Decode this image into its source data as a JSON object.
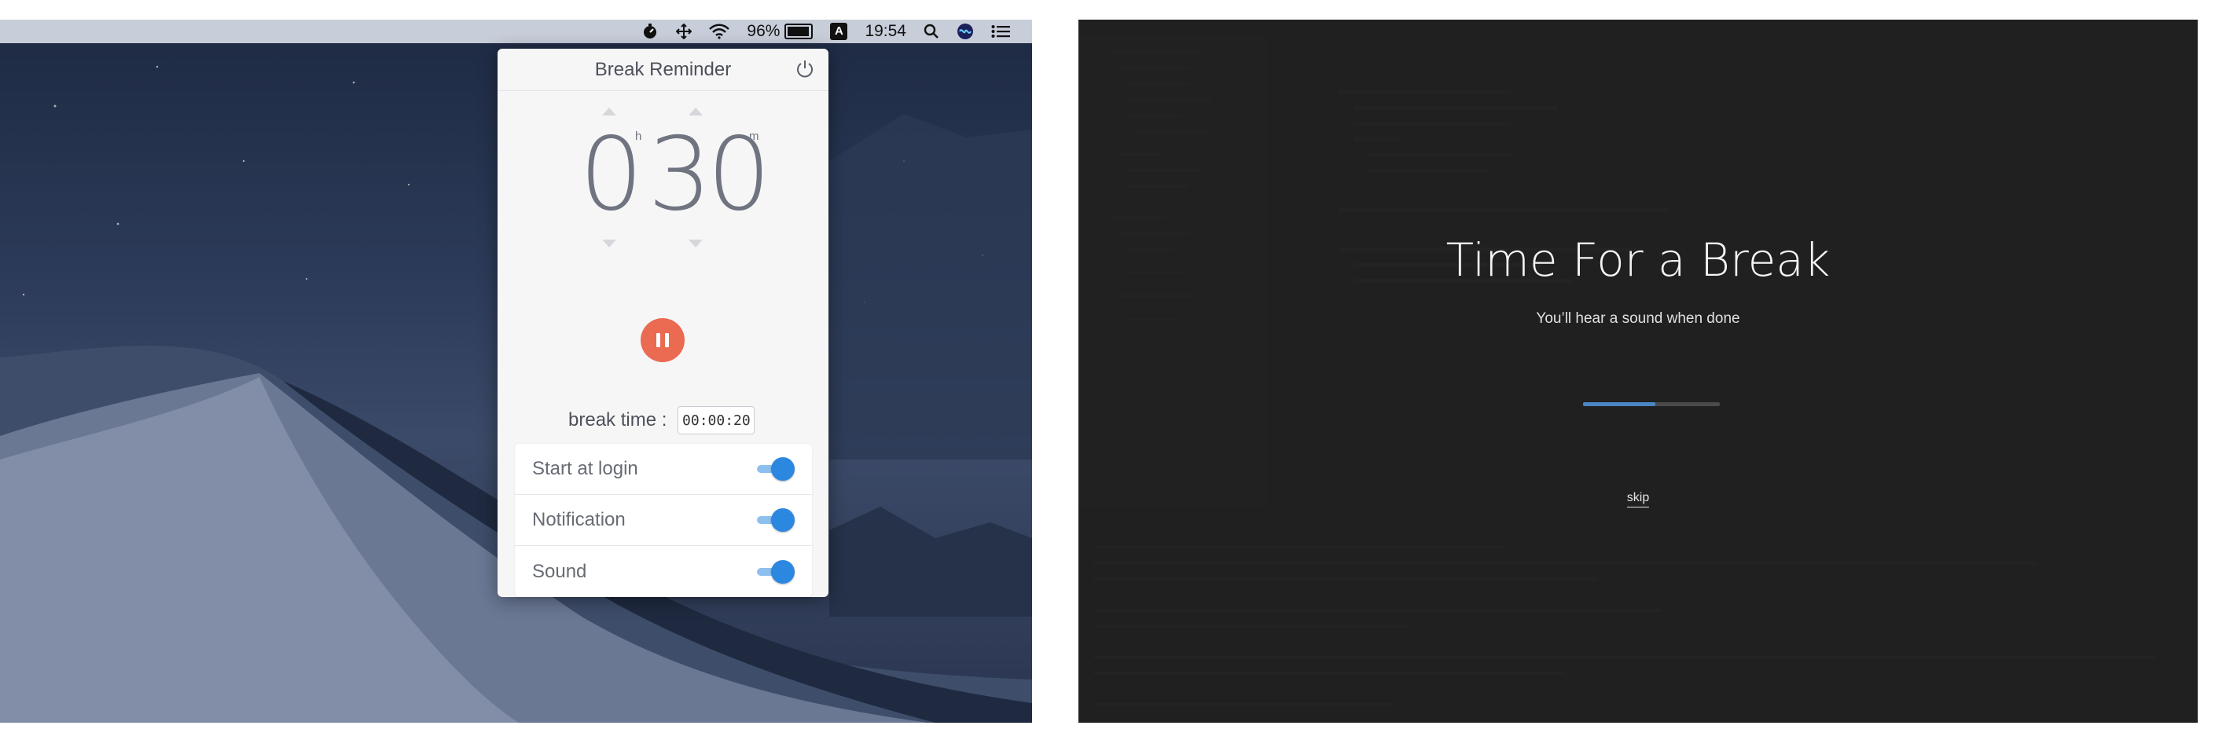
{
  "menubar": {
    "battery_percent": "96%",
    "battery_level": 0.96,
    "keyboard_input": "A",
    "clock": "19:54",
    "icons": [
      "break-reminder-icon",
      "move-icon",
      "wifi-icon",
      "battery-icon",
      "keyboard-input-icon",
      "spotlight-search-icon",
      "siri-icon",
      "notification-center-icon"
    ]
  },
  "popover": {
    "title": "Break Reminder",
    "hours": "0",
    "hours_unit": "h",
    "minutes": "30",
    "minutes_unit": "m",
    "break_time_label": "break time :",
    "break_time_value": "00:00:20",
    "settings": [
      {
        "label": "Start at login",
        "enabled": true
      },
      {
        "label": "Notification",
        "enabled": true
      },
      {
        "label": "Sound",
        "enabled": true
      }
    ]
  },
  "break_screen": {
    "title": "Time For a Break",
    "subtitle": "You’ll hear a sound when done",
    "progress": 0.53,
    "skip_label": "skip"
  },
  "colors": {
    "pause_button": "#ea6a52",
    "toggle_on": "#2c87e0",
    "progress_fill": "#4a86c5",
    "overlay_bg": "#212121"
  }
}
